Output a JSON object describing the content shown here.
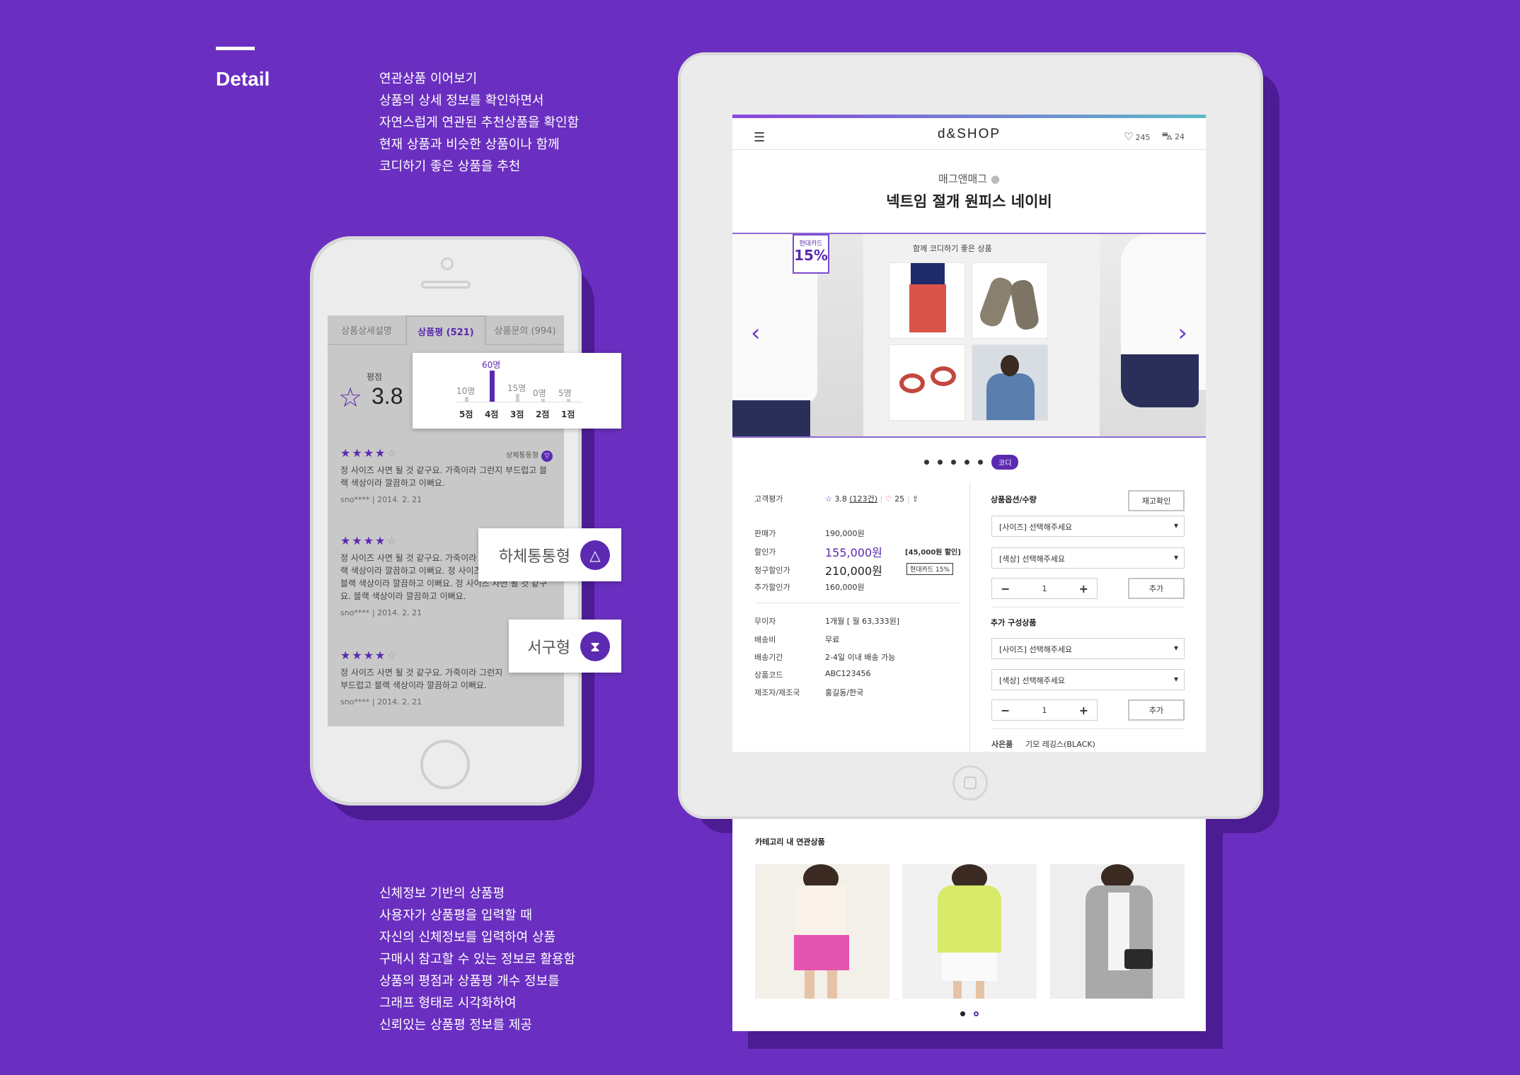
{
  "section": {
    "title": "Detail"
  },
  "desc_top": [
    "연관상품 이어보기",
    "상품의 상세 정보를 확인하면서",
    "자연스럽게 연관된 추천상품을 확인함",
    "현재 상품과 비슷한 상품이나 함께",
    "코디하기 좋은 상품을 추천"
  ],
  "desc_bottom": [
    "신체정보 기반의 상품평",
    "사용자가 상품평을 입력할 때",
    "자신의 신체정보를 입력하여 상품",
    "구매시 참고할 수 있는 정보로 활용함",
    "상품의 평점과 상품평 개수 정보를",
    "그래프 형태로 시각화하여",
    "신뢰있는 상품평 정보를 제공"
  ],
  "phone": {
    "tabs": [
      "상품상세설명",
      "상품평 (521)",
      "상품문의 (994)"
    ],
    "rating_label": "평점",
    "rating_value": "3.8",
    "reviews": [
      {
        "stars": 4,
        "tag": "상체통통형",
        "text": "정 사이즈 사면 될 것 같구요. 가죽이라 그런지 부드럽고 블랙 색상이라 깔끔하고 이뻐요.",
        "meta": "sno****  |  2014. 2. 21"
      },
      {
        "stars": 4,
        "tag": "",
        "text": "정 사이즈 사면 될 것 같구요. 가죽이라 그런지 부드럽고 블랙 색상이라 깔끔하고 이뻐요. 정 사이즈 사면 될 것 같구요. 블랙 색상이라 깔끔하고 이뻐요. 정 사이즈 사면 될 것 같구요. 블랙 색상이라 깔끔하고 이뻐요.",
        "meta": "sno****  |  2014. 2. 21"
      },
      {
        "stars": 4,
        "tag": "하체",
        "text": "정 사이즈 사면 될 것 같구요. 가죽이라 그런지 부드럽고 블랙 색상이라 깔끔하고 이뻐요.",
        "meta": "sno****  |  2014. 2. 21"
      }
    ]
  },
  "chart_data": {
    "type": "bar",
    "categories": [
      "5점",
      "4점",
      "3점",
      "2점",
      "1점"
    ],
    "value_labels": [
      "10명",
      "60명",
      "15명",
      "0명",
      "5명"
    ],
    "values": [
      10,
      60,
      15,
      0,
      5
    ],
    "highlight_index": 1,
    "color": "#5b2ab0"
  },
  "body_types": [
    {
      "label": "하체통통형",
      "icon": "△"
    },
    {
      "label": "서구형",
      "icon": "⧗"
    }
  ],
  "tablet": {
    "logo": "d&SHOP",
    "wish_count": "245",
    "cart_count": "24",
    "brand": "매그앤매그",
    "product_name": "넥트임 절개 원피스 네이비",
    "card_badge": {
      "small": "현대카드",
      "big": "15%"
    },
    "coord_title": "함께 코디하기 좋은 상품",
    "coord_tag": "코디",
    "rating_label": "고객평가",
    "rating": "3.8",
    "rating_count": "(123건)",
    "likes": "25",
    "prices": [
      {
        "k": "판매가",
        "v": "190,000원"
      },
      {
        "k": "할인가",
        "v": "155,000원",
        "extra": "[45,000원 할인]"
      },
      {
        "k": "청구할인가",
        "v": "210,000원",
        "extra": "현대카드 15%"
      },
      {
        "k": "추가할인가",
        "v": "160,000원"
      }
    ],
    "details": [
      {
        "k": "무이자",
        "v": "1개월 [ 월 63,333원]"
      },
      {
        "k": "배송비",
        "v": "무료"
      },
      {
        "k": "배송기간",
        "v": "2-4일 이내 배송 가능"
      },
      {
        "k": "상품코드",
        "v": "ABC123456"
      },
      {
        "k": "제조자/제조국",
        "v": "홍길동/한국"
      }
    ],
    "options_label": "상품옵션/수량",
    "stock_btn": "재고확인",
    "size_select": "[사이즈] 선택해주세요",
    "color_select": "[색상] 선택해주세요",
    "qty": "1",
    "add_btn": "추가",
    "addon_label": "추가 구성상품",
    "gift_label": "사은품",
    "gift_value": "기모 레깅스(BLACK)"
  },
  "related": {
    "title": "카테고리 내 연관상품"
  }
}
